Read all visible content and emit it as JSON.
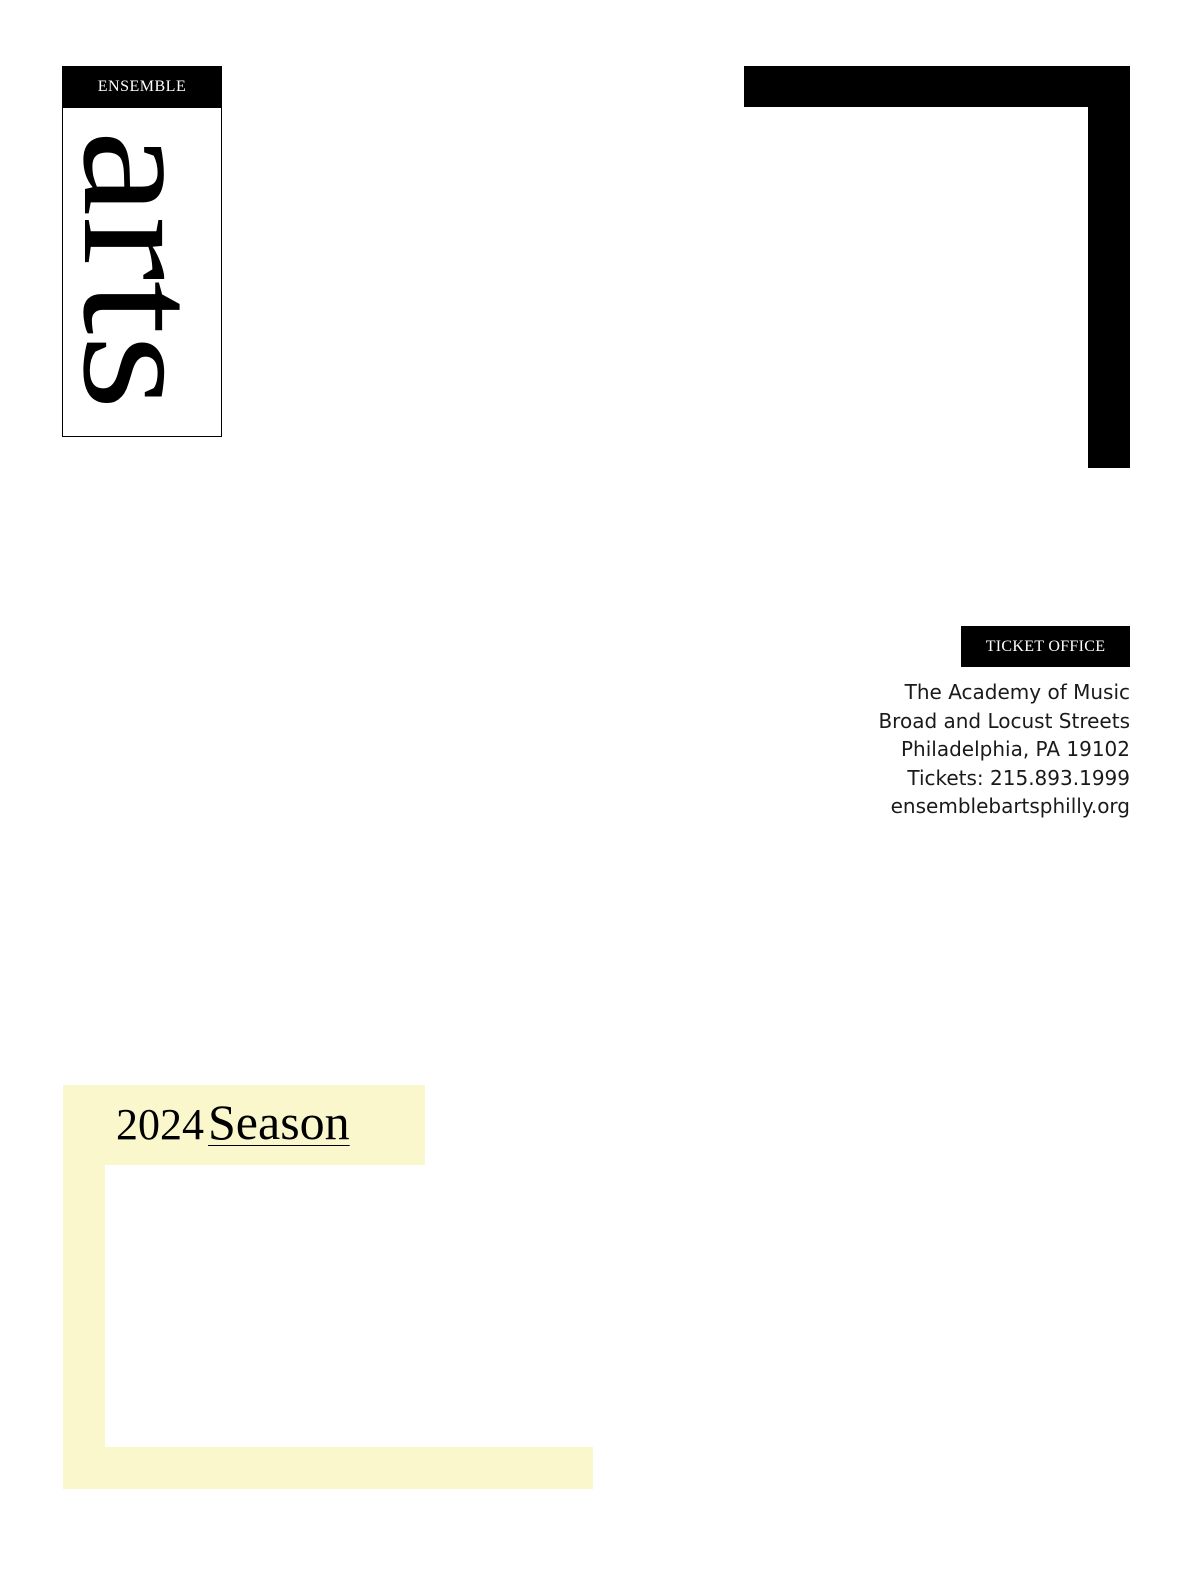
{
  "logo": {
    "top_label": "ENSEMBLE",
    "word": "arts"
  },
  "ticket_office": {
    "label": "TICKET OFFICE",
    "address_lines": [
      "The Academy of Music",
      "Broad and Locust Streets",
      "Philadelphia, PA 19102",
      "Tickets: 215.893.1999",
      "ensemblebartsphilly.org"
    ]
  },
  "season": {
    "year": "2024",
    "word": "Season"
  },
  "colors": {
    "black": "#000000",
    "season_highlight": "#faf7cc",
    "background": "#ffffff"
  }
}
